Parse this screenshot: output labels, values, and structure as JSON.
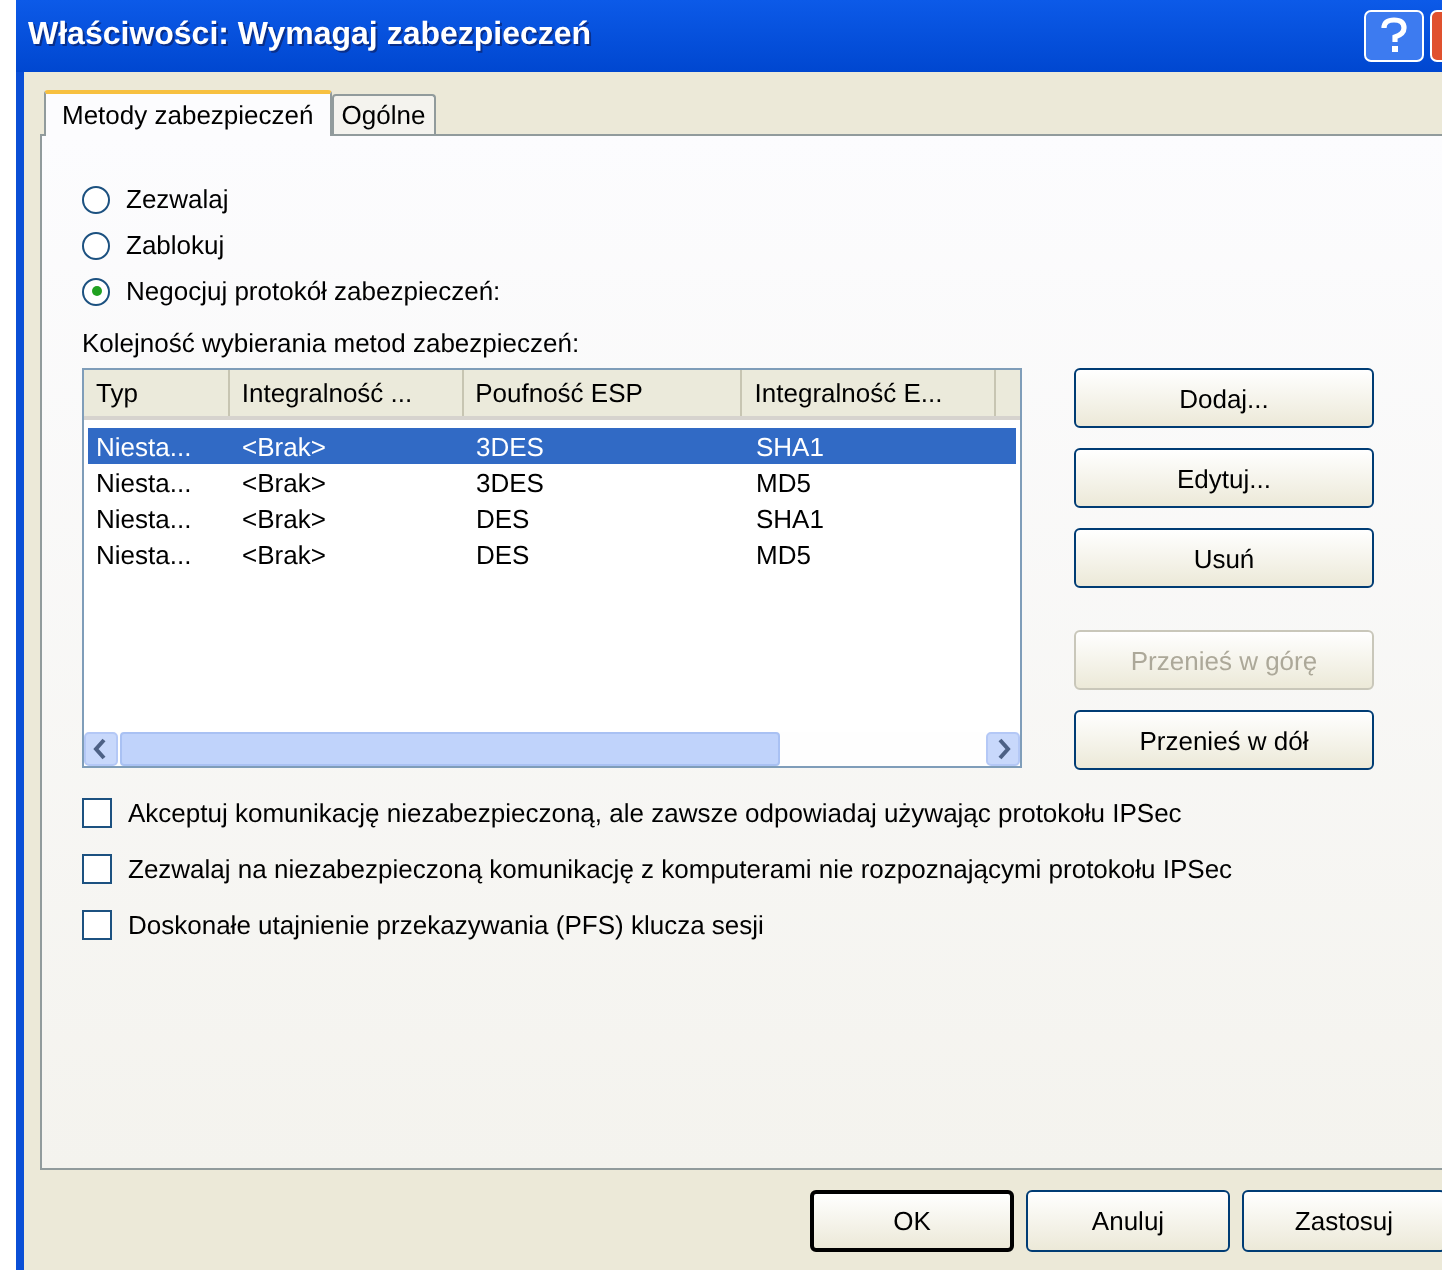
{
  "window": {
    "title": "Właściwości: Wymagaj zabezpieczeń"
  },
  "tabs": [
    {
      "label": "Metody zabezpieczeń",
      "selected": true
    },
    {
      "label": "Ogólne",
      "selected": false
    }
  ],
  "actions": [
    {
      "label": "Zezwalaj",
      "selected": false
    },
    {
      "label": "Zablokuj",
      "selected": false
    },
    {
      "label": "Negocjuj protokół zabezpieczeń:",
      "selected": true
    }
  ],
  "methods_label": "Kolejność wybierania metod zabezpieczeń:",
  "table": {
    "columns": [
      "Typ",
      "Integralność ...",
      "Poufność ESP",
      "Integralność E..."
    ],
    "rows": [
      {
        "cells": [
          "Niesta...",
          "<Brak>",
          "3DES",
          "SHA1"
        ],
        "selected": true
      },
      {
        "cells": [
          "Niesta...",
          "<Brak>",
          "3DES",
          "MD5"
        ],
        "selected": false
      },
      {
        "cells": [
          "Niesta...",
          "<Brak>",
          "DES",
          "SHA1"
        ],
        "selected": false
      },
      {
        "cells": [
          "Niesta...",
          "<Brak>",
          "DES",
          "MD5"
        ],
        "selected": false
      }
    ]
  },
  "side_buttons": [
    {
      "label": "Dodaj...",
      "disabled": false
    },
    {
      "label": "Edytuj...",
      "disabled": false
    },
    {
      "label": "Usuń",
      "disabled": false
    },
    {
      "label": "Przenieś w górę",
      "disabled": true
    },
    {
      "label": "Przenieś w dół",
      "disabled": false
    }
  ],
  "options": [
    {
      "label": "Akceptuj komunikację niezabezpieczoną, ale zawsze odpowiadaj używając protokołu IPSec",
      "checked": false
    },
    {
      "label": "Zezwalaj na niezabezpieczoną komunikację z komputerami nie rozpoznającymi protokołu IPSec",
      "checked": false
    },
    {
      "label": "Doskonałe utajnienie przekazywania (PFS) klucza sesji",
      "checked": false
    }
  ],
  "dialog_buttons": [
    {
      "label": "OK",
      "default": true
    },
    {
      "label": "Anuluj",
      "default": false
    },
    {
      "label": "Zastosuj",
      "default": false
    }
  ]
}
